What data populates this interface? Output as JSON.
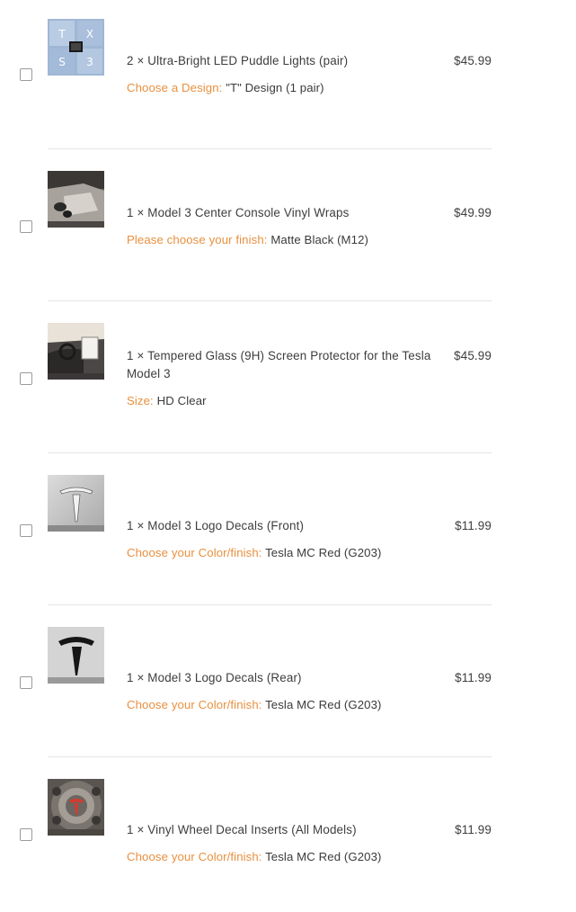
{
  "items": [
    {
      "title": "2 × Ultra-Bright LED Puddle Lights (pair)",
      "price": "$45.99",
      "option_label": "Choose a Design:",
      "option_value": "\"T\" Design (1 pair)",
      "thumb_icon": "puddle-lights-thumbnail"
    },
    {
      "title": "1 × Model 3 Center Console Vinyl Wraps",
      "price": "$49.99",
      "option_label": "Please choose your finish:",
      "option_value": "Matte Black (M12)",
      "thumb_icon": "center-console-thumbnail"
    },
    {
      "title": "1 × Tempered Glass (9H) Screen Protector for the Tesla Model 3",
      "price": "$45.99",
      "option_label": "Size:",
      "option_value": "HD Clear",
      "thumb_icon": "screen-protector-thumbnail"
    },
    {
      "title": "1 × Model 3 Logo Decals (Front)",
      "price": "$11.99",
      "option_label": "Choose your Color/finish:",
      "option_value": "Tesla MC Red (G203)",
      "thumb_icon": "logo-decal-front-thumbnail"
    },
    {
      "title": "1 × Model 3 Logo Decals (Rear)",
      "price": "$11.99",
      "option_label": "Choose your Color/finish:",
      "option_value": "Tesla MC Red (G203)",
      "thumb_icon": "logo-decal-rear-thumbnail"
    },
    {
      "title": "1 × Vinyl Wheel Decal Inserts (All Models)",
      "price": "$11.99",
      "option_label": "Choose your Color/finish:",
      "option_value": "Tesla MC Red (G203)",
      "thumb_icon": "wheel-decal-thumbnail"
    }
  ],
  "colors": {
    "option_label": "#e8903f",
    "divider": "#e4e4e4",
    "text": "#3d3d3d"
  }
}
